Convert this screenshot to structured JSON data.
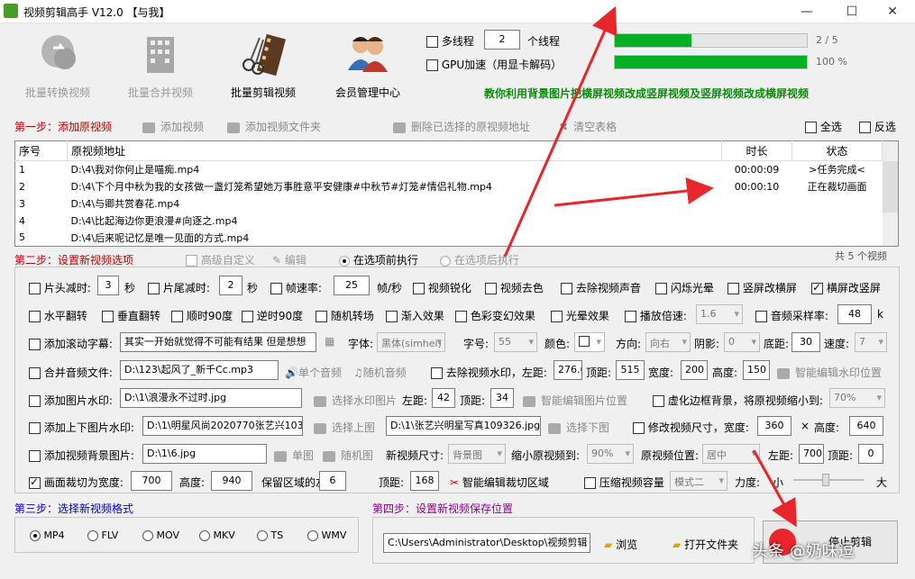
{
  "window": {
    "title": "视频剪辑高手 V12.0  【与我】",
    "min": "—",
    "max": "☐",
    "close": "✕"
  },
  "top": {
    "tools": [
      {
        "label": "批量转换视频",
        "icon": "convert-icon",
        "enabled": false
      },
      {
        "label": "批量合并视频",
        "icon": "building-icon",
        "enabled": false
      },
      {
        "label": "批量剪辑视频",
        "icon": "film-scissors-icon",
        "enabled": true
      },
      {
        "label": "会员管理中心",
        "icon": "users-icon",
        "enabled": true
      }
    ],
    "multithread_label": "多线程",
    "threads_value": "2",
    "threads_unit": "个线程",
    "gpu_label": "GPU加速（用显卡解码）",
    "progress1_text": "2 / 5",
    "progress1_value": 0.4,
    "progress2_text": "100 %",
    "progress2_value": 1.0,
    "banner": "教你利用背景图片把横屏视频改成竖屏视频及竖屏视频改成横屏视频"
  },
  "step1": {
    "title": "第一步：添加原视频",
    "add_video": "添加视频",
    "add_folder": "添加视频文件夹",
    "remove_selected": "删除已选择的原视频地址",
    "clear_table": "清空表格",
    "select_all": "全选",
    "invert": "反选",
    "columns": [
      "序号",
      "原视频地址",
      "时长",
      "状态"
    ],
    "rows": [
      {
        "no": "1",
        "path": "D:\\4\\我对你何止是喵痴.mp4",
        "duration": "00:00:09",
        "status": ">任务完成<"
      },
      {
        "no": "2",
        "path": "D:\\4\\下个月中秋为我的女孩做一盏灯笼希望她万事胜意平安健康#中秋节#灯笼#情侣礼物.mp4",
        "duration": "00:00:10",
        "status": "正在裁切画面"
      },
      {
        "no": "3",
        "path": "D:\\4\\与卿共赏春花.mp4",
        "duration": "",
        "status": ""
      },
      {
        "no": "4",
        "path": "D:\\4\\比起海边你更浪漫#向逐之.mp4",
        "duration": "",
        "status": ""
      },
      {
        "no": "5",
        "path": "D:\\4\\后来呢记忆是唯一见面的方式.mp4",
        "duration": "",
        "status": ""
      }
    ],
    "count_text": "共 5 个视频"
  },
  "step2": {
    "title": "第二步：设置新视频选项",
    "advanced": "高级自定义",
    "edit": "编辑",
    "before": "在选项前执行",
    "after": "在选项后执行",
    "r1": {
      "head_cut": "片头减时:",
      "head_val": "3",
      "sec": "秒",
      "tail_cut": "片尾减时:",
      "tail_val": "2",
      "frame_rate": "帧速率:",
      "fr_val": "25",
      "fr_unit": "帧/秒",
      "sharpen": "视频锐化",
      "decolor": "视频去色",
      "remove_audio": "去除视频声音",
      "flash": "闪烁光晕",
      "v2h": "竖屏改横屏",
      "h2v": "横屏改竖屏"
    },
    "r2": {
      "hflip": "水平翻转",
      "vflip": "垂直翻转",
      "cw90": "顺时90度",
      "ccw90": "逆时90度",
      "transition": "随机转场",
      "fade": "渐入效果",
      "color": "色彩变幻效果",
      "halo": "光晕效果",
      "speed": "播放倍速:",
      "speed_val": "1.6",
      "sample": "音频采样率:",
      "sample_val": "48",
      "k": "k"
    },
    "r3": {
      "scroll": "添加滚动字幕:",
      "scroll_text": "其实一开始就觉得不可能有结果 但是想想",
      "font": "字体:",
      "font_val": "黑体(simhei)",
      "size": "字号:",
      "size_val": "55",
      "color": "颜色:",
      "direction": "方向:",
      "dir_val": "向右",
      "shadow": "阴影:",
      "shadow_val": "0",
      "bottom": "底距:",
      "bottom_val": "30",
      "spd": "速度:",
      "spd_val": "7"
    },
    "r4": {
      "merge_audio": "合并音频文件:",
      "audio_path": "D:\\123\\起风了_新千Cc.mp3",
      "single": "单个音频",
      "random": "随机音频",
      "remove_wm": "去除视频水印，左距:",
      "left": "276.6",
      "top_lbl": "顶距:",
      "top": "515",
      "width_lbl": "宽度:",
      "width": "200",
      "height_lbl": "高度:",
      "height": "150",
      "smart": "智能编辑水印位置"
    },
    "r5": {
      "img_wm": "添加图片水印:",
      "img_path": "D:\\1\\浪漫永不过时.jpg",
      "choose": "选择水印图片",
      "left_lbl": "左距:",
      "left": "42",
      "top_lbl": "顶距:",
      "top": "34",
      "smart": "智能编辑图片位置",
      "blur": "虚化边框背景，将原视频缩小到:",
      "blur_val": "70%"
    },
    "r6": {
      "tb_wm": "添加上下图片水印:",
      "up_path": "D:\\1\\明星风尚2020770张艺兴103",
      "up": "选择上图",
      "down_path": "D:\\1\\张艺兴明星写真109326.jpg",
      "down": "选择下图",
      "resize": "修改视频尺寸，宽度:",
      "w": "360",
      "x": "×",
      "h_lbl": "高度:",
      "h": "640"
    },
    "r7": {
      "bg": "添加视频背景图片:",
      "bg_path": "D:\\1\\6.jpg",
      "single": "单图",
      "random": "随机图",
      "new_size": "新视频尺寸:",
      "size_val": "背景图",
      "shrink": "缩小原视频到:",
      "shrink_val": "90%",
      "pos": "原视频位置:",
      "pos_val": "居中",
      "left_lbl": "左距:",
      "left": "700",
      "top_lbl": "顶距:",
      "top": "0"
    },
    "r8": {
      "crop": "画面裁切为宽度:",
      "w": "700",
      "h_lbl": "高度:",
      "h": "940",
      "keep": "保留区域的左距:",
      "left": "6",
      "top_lbl": "顶距:",
      "top": "168",
      "smart": "智能编辑裁切区域",
      "compress": "压缩视频容量",
      "mode": "模式二",
      "strength": "力度:",
      "small": "小",
      "big": "大"
    }
  },
  "step3": {
    "title": "第三步：选择新视频格式",
    "formats": [
      "MP4",
      "FLV",
      "MOV",
      "MKV",
      "TS",
      "WMV"
    ]
  },
  "step4": {
    "title": "第四步：设置新视频保存位置",
    "path": "C:\\Users\\Administrator\\Desktop\\视频剪辑",
    "browse": "浏览",
    "open": "打开文件夹",
    "stop": "停止剪辑"
  },
  "watermark": "头条 @奶味逗",
  "colors": {
    "accent_red": "#c00000",
    "step_blue": "#0000cc",
    "step_purple": "#8b008b",
    "banner_green": "#0a8a0a",
    "progress_green": "#06b025",
    "arrow_red": "#e8262b"
  }
}
